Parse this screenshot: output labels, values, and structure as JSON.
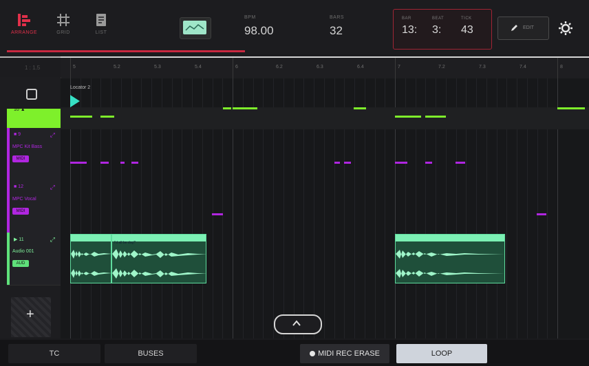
{
  "top": {
    "modes": [
      {
        "label": "ARRANGE",
        "active": true,
        "icon": "arrange-icon"
      },
      {
        "label": "GRID",
        "active": false,
        "icon": "grid-icon"
      },
      {
        "label": "LIST",
        "active": false,
        "icon": "list-icon"
      }
    ],
    "bpm_caption": "BPM",
    "bpm_value": "98.00",
    "bars_caption": "BARS",
    "bars_value": "32",
    "counter": {
      "bar_caption": "BAR",
      "beat_caption": "BEAT",
      "tick_caption": "TICK",
      "bar": "13:",
      "beat": "3:",
      "tick": "43"
    },
    "edit_label": "EDIT"
  },
  "ruler": {
    "left_label": "1 : 1.5",
    "ticks": [
      "5",
      "5.2",
      "5.3",
      "5.4",
      "6",
      "6.2",
      "6.3",
      "6.4",
      "7",
      "7.2",
      "7.3",
      "7.4",
      "8"
    ]
  },
  "locator": {
    "label": "Locator 2"
  },
  "tracks": [
    {
      "num": "10 ▲",
      "name": "",
      "badge": "",
      "color": "#7ef02b"
    },
    {
      "num": "■ 9",
      "name": "MPC Kit Bass",
      "badge": "MIDI",
      "color": "#b026e0"
    },
    {
      "num": "■ 12",
      "name": "MPC Vocal",
      "badge": "MIDI",
      "color": "#b026e0"
    },
    {
      "num": "▶ 11",
      "name": "Audio 001",
      "badge": "AUD",
      "color": "#5fe07a"
    }
  ],
  "clips": {
    "audio_clip_name": "I'd all be dog?"
  },
  "bottom": {
    "tc": "TC",
    "buses": "BUSES",
    "midi_rec_erase": "MIDI REC ERASE",
    "loop": "LOOP"
  },
  "colors": {
    "accent": "#c82840",
    "green": "#7ef02b",
    "purple": "#b026e0",
    "audio": "#5fdc9e"
  }
}
